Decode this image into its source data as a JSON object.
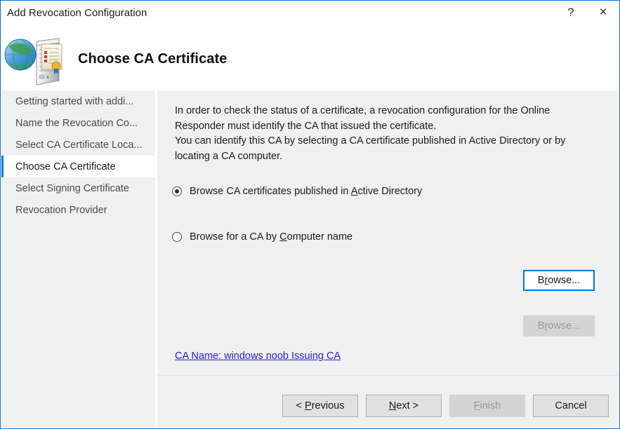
{
  "window": {
    "title": "Add Revocation Configuration",
    "help_label": "?",
    "close_label": "×",
    "accent_color": "#0078d7",
    "icon_name": "online-responder-certificate-icon"
  },
  "header": {
    "heading": "Choose CA Certificate"
  },
  "sidebar": {
    "items": [
      {
        "label": "Getting started with addi...",
        "selected": false
      },
      {
        "label": "Name the Revocation Co...",
        "selected": false
      },
      {
        "label": "Select CA Certificate Loca...",
        "selected": false
      },
      {
        "label": "Choose CA Certificate",
        "selected": true
      },
      {
        "label": "Select Signing Certificate",
        "selected": false
      },
      {
        "label": "Revocation Provider",
        "selected": false
      }
    ]
  },
  "content": {
    "intro_line1": "In order to check the status of a certificate, a revocation configuration for the Online",
    "intro_line2": "Responder must identify the CA that issued the certificate.",
    "intro_line3": "You can identify this CA by selecting a CA certificate published in Active Directory or by",
    "intro_line4": "locating a CA computer.",
    "options": [
      {
        "label_before": "Browse CA certificates published in ",
        "accel": "A",
        "label_after": "ctive Directory",
        "checked": true,
        "button": {
          "label_before": "B",
          "accel": "r",
          "label_after": "owse...",
          "disabled": false
        }
      },
      {
        "label_before": "Browse for a CA by ",
        "accel": "C",
        "label_after": "omputer name",
        "checked": false,
        "button": {
          "label_before": "B",
          "accel": "r",
          "label_after": "owse...",
          "disabled": true
        }
      }
    ],
    "ca_link": "CA Name: windows noob Issuing CA"
  },
  "footer": {
    "buttons": [
      {
        "prefix": "< ",
        "accel": "P",
        "suffix": "revious",
        "disabled": false
      },
      {
        "prefix": "",
        "accel": "N",
        "suffix": "ext >",
        "disabled": false
      },
      {
        "prefix": "",
        "accel": "F",
        "suffix": "inish",
        "disabled": true
      },
      {
        "prefix": "",
        "accel": "",
        "suffix": "Cancel",
        "disabled": false
      }
    ]
  }
}
